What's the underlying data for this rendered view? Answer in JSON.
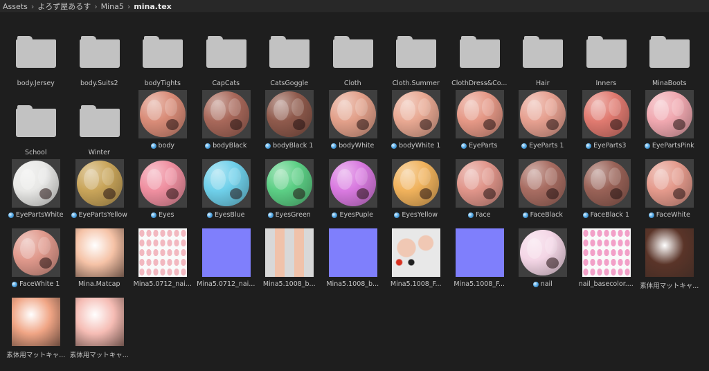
{
  "breadcrumb": [
    "Assets",
    "よろず屋あるす",
    "Mina5",
    "mina.tex"
  ],
  "items": [
    {
      "label": "body.Jersey",
      "kind": "folder",
      "color": ""
    },
    {
      "label": "body.Suits2",
      "kind": "folder",
      "color": ""
    },
    {
      "label": "bodyTights",
      "kind": "folder",
      "color": ""
    },
    {
      "label": "CapCats",
      "kind": "folder",
      "color": ""
    },
    {
      "label": "CatsGoggle",
      "kind": "folder",
      "color": ""
    },
    {
      "label": "Cloth",
      "kind": "folder",
      "color": ""
    },
    {
      "label": "Cloth.Summer",
      "kind": "folder",
      "color": ""
    },
    {
      "label": "ClothDress&Co...",
      "kind": "folder",
      "color": ""
    },
    {
      "label": "Hair",
      "kind": "folder",
      "color": ""
    },
    {
      "label": "Inners",
      "kind": "folder",
      "color": ""
    },
    {
      "label": "MinaBoots",
      "kind": "folder",
      "color": ""
    },
    {
      "label": "School",
      "kind": "folder",
      "color": ""
    },
    {
      "label": "Winter",
      "kind": "folder",
      "color": ""
    },
    {
      "label": "body",
      "kind": "material",
      "color": "#d98c78"
    },
    {
      "label": "bodyBlack",
      "kind": "material",
      "color": "#a8685a"
    },
    {
      "label": "bodyBlack 1",
      "kind": "material",
      "color": "#8f5a4c"
    },
    {
      "label": "bodyWhite",
      "kind": "material",
      "color": "#e2a08a"
    },
    {
      "label": "bodyWhite 1",
      "kind": "material",
      "color": "#e8a892"
    },
    {
      "label": "EyeParts",
      "kind": "material",
      "color": "#e59886"
    },
    {
      "label": "EyeParts 1",
      "kind": "material",
      "color": "#e6a090"
    },
    {
      "label": "EyeParts3",
      "kind": "material",
      "color": "#e07a70"
    },
    {
      "label": "EyePartsPink",
      "kind": "material",
      "color": "#f0a8b0"
    },
    {
      "label": "EyePartsWhite",
      "kind": "material",
      "color": "#e8e8e6"
    },
    {
      "label": "EyePartsYellow",
      "kind": "material",
      "color": "#c9a55a"
    },
    {
      "label": "Eyes",
      "kind": "material",
      "color": "#ef8fa0"
    },
    {
      "label": "EyesBlue",
      "kind": "material",
      "color": "#6fd0ea"
    },
    {
      "label": "EyesGreen",
      "kind": "material",
      "color": "#5ccf85"
    },
    {
      "label": "EyesPuple",
      "kind": "material",
      "color": "#d97ae0"
    },
    {
      "label": "EyesYellow",
      "kind": "material",
      "color": "#f0b25c"
    },
    {
      "label": "Face",
      "kind": "material",
      "color": "#e0958a"
    },
    {
      "label": "FaceBlack",
      "kind": "material",
      "color": "#a86d62"
    },
    {
      "label": "FaceBlack 1",
      "kind": "material",
      "color": "#996257"
    },
    {
      "label": "FaceWhite",
      "kind": "material",
      "color": "#e49a8c"
    },
    {
      "label": "FaceWhite 1",
      "kind": "material",
      "color": "#e0998c"
    },
    {
      "label": "Mina.Matcap",
      "kind": "matcap",
      "color": "#f5c2a6"
    },
    {
      "label": "Mina5.0712_nai...",
      "kind": "texture-nails",
      "color": "#f2b8c0"
    },
    {
      "label": "Mina5.0712_nai...",
      "kind": "normal",
      "color": "#7f7ffc"
    },
    {
      "label": "Mina5.1008_b...",
      "kind": "texture-body",
      "color": "#f0c2aa"
    },
    {
      "label": "Mina5.1008_b...",
      "kind": "normal",
      "color": "#7f7ffc"
    },
    {
      "label": "Mina5.1008_F...",
      "kind": "texture-face",
      "color": "#f0c8b4"
    },
    {
      "label": "Mina5.1008_F...",
      "kind": "normal",
      "color": "#7f7ffc"
    },
    {
      "label": "nail",
      "kind": "material-nail",
      "color": "#f4d6e6"
    },
    {
      "label": "nail_basecolor....",
      "kind": "texture-nails",
      "color": "#f2a0c8"
    },
    {
      "label": "素体用マットキャ...",
      "kind": "matcap",
      "color": "#5a3428"
    },
    {
      "label": "素体用マットキャ...",
      "kind": "matcap",
      "color": "#f0a585"
    },
    {
      "label": "素体用マットキャ...",
      "kind": "matcap",
      "color": "#f5bcb4"
    }
  ]
}
